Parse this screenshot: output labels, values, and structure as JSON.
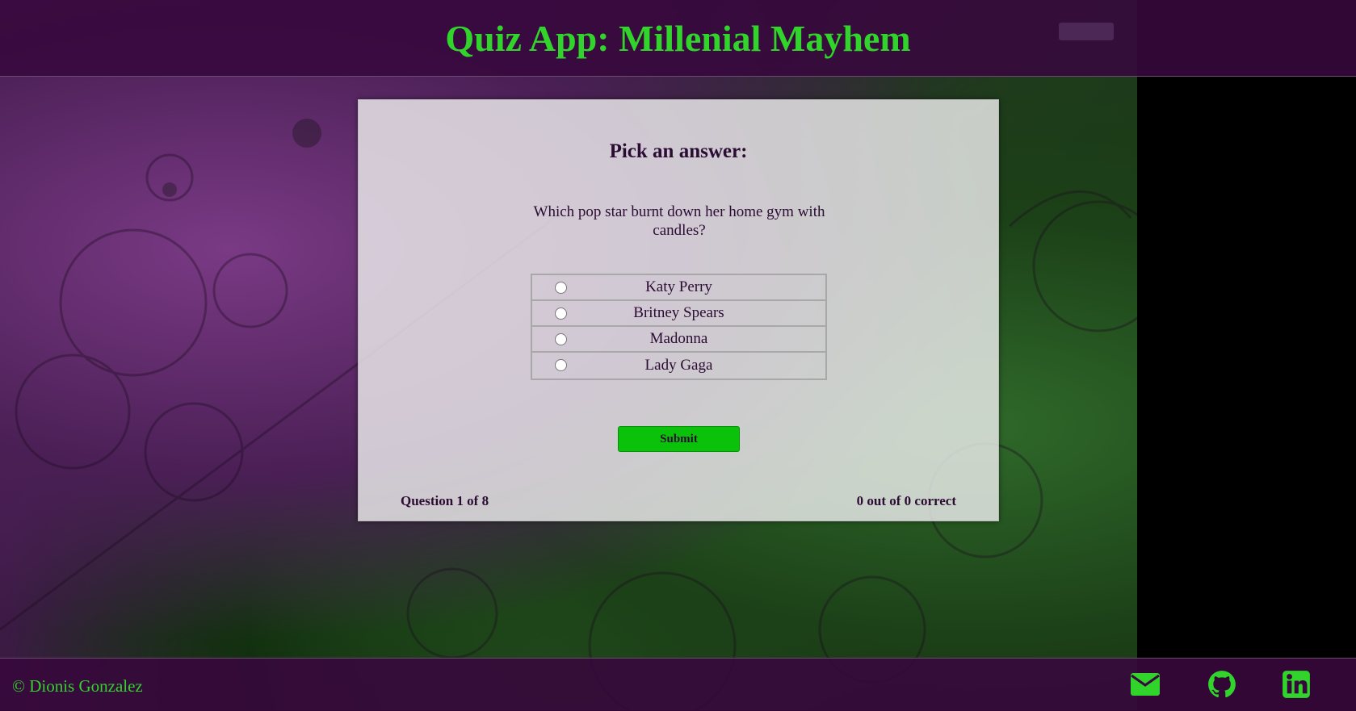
{
  "header": {
    "title": "Quiz App: Millenial Mayhem"
  },
  "quiz": {
    "heading": "Pick an answer:",
    "question": "Which pop star burnt down her home gym with candles?",
    "answers": [
      {
        "label": "Katy Perry"
      },
      {
        "label": "Britney Spears"
      },
      {
        "label": "Madonna"
      },
      {
        "label": "Lady Gaga"
      }
    ],
    "submit_label": "Submit",
    "progress": "Question 1 of 8",
    "score": "0 out of 0 correct"
  },
  "footer": {
    "copyright": "© Dionis Gonzalez",
    "icons": [
      "envelope-icon",
      "github-icon",
      "linkedin-icon"
    ]
  },
  "colors": {
    "accent": "#31d42b",
    "header_bg": "#37083c",
    "text_dark": "#2b0c33",
    "button": "#0bc20b"
  }
}
